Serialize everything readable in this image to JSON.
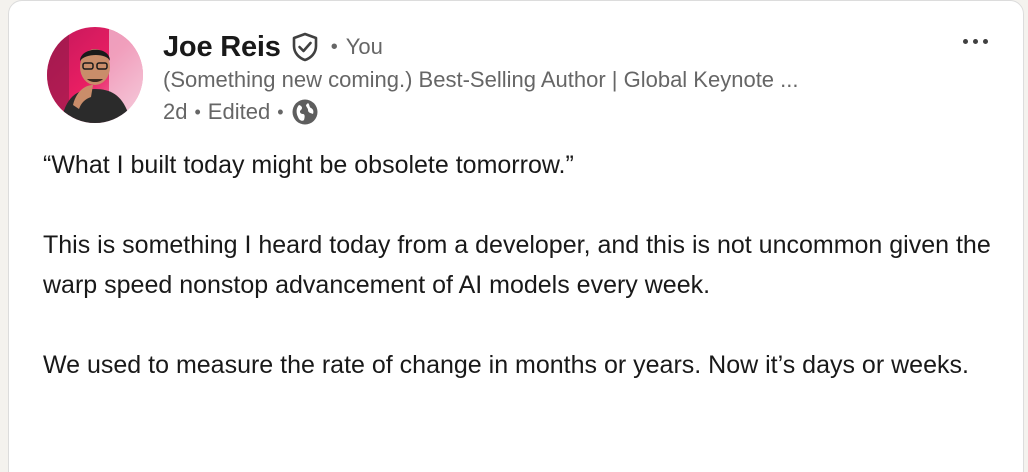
{
  "post": {
    "author": {
      "name": "Joe Reis",
      "relation": "You",
      "headline": "(Something new coming.) Best-Selling Author | Global Keynote ...",
      "verified_icon": "verified-shield-icon"
    },
    "meta": {
      "time": "2d",
      "edited": "Edited",
      "visibility_icon": "globe-icon"
    },
    "more_icon": "more-options-icon",
    "paragraphs": [
      "“What I built today might be obsolete tomorrow.”",
      "This is something I heard today from a developer, and this is not uncommon given the warp speed nonstop advancement of AI models every week.",
      "We used to measure the rate of change in months or years. Now it’s days or weeks."
    ]
  }
}
